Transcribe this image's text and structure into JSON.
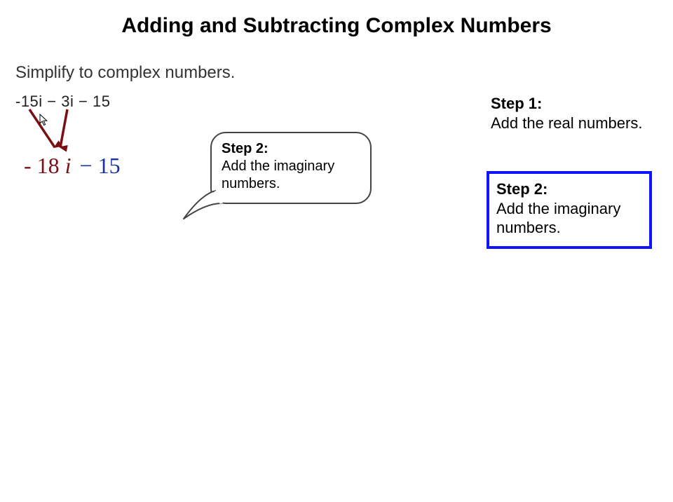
{
  "title": "Adding and Subtracting Complex Numbers",
  "instruction": "Simplify to complex numbers.",
  "expression": "-15i − 3i − 15",
  "result": {
    "imag": "- 18",
    "imag_i": "i",
    "real_sign": "−",
    "real_val": "15"
  },
  "bubble": {
    "label": "Step 2:",
    "text": "Add the imaginary numbers."
  },
  "step1": {
    "label": "Step 1:",
    "text": "Add the real numbers."
  },
  "step2": {
    "label": "Step 2:",
    "text": "Add the imaginary numbers."
  },
  "colors": {
    "arrow": "#7a1015",
    "step_highlight": "#1112ff",
    "imag": "#7a1015",
    "real": "#1733a8"
  }
}
